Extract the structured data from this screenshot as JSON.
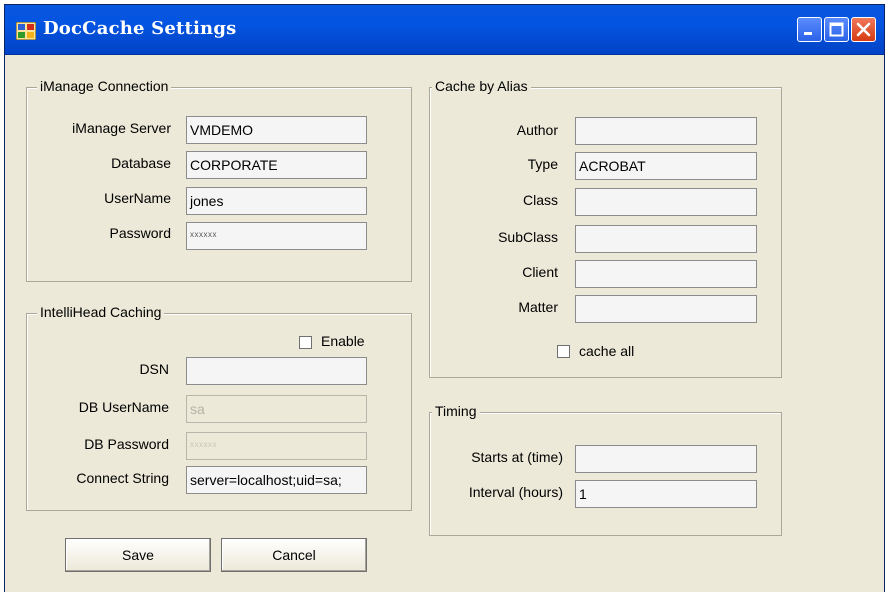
{
  "window": {
    "title": "DocCache Settings",
    "icons": {
      "app": "app-icon",
      "minimize": "minimize-icon",
      "maximize": "maximize-icon",
      "close": "close-icon"
    }
  },
  "imanage": {
    "legend": "iManage Connection",
    "server_label": "iManage Server",
    "server_value": "VMDEMO",
    "database_label": "Database",
    "database_value": "CORPORATE",
    "username_label": "UserName",
    "username_value": "jones",
    "password_label": "Password",
    "password_value": "xxxxxx"
  },
  "intellihead": {
    "legend": "IntelliHead Caching",
    "enable_label": "Enable",
    "enable_checked": false,
    "dsn_label": "DSN",
    "dsn_value": "",
    "db_username_label": "DB UserName",
    "db_username_value": "sa",
    "db_password_label": "DB Password",
    "db_password_value": "xxxxxx",
    "connect_label": "Connect String",
    "connect_value": "server=localhost;uid=sa;"
  },
  "alias": {
    "legend": "Cache by Alias",
    "author_label": "Author",
    "author_value": "",
    "type_label": "Type",
    "type_value": "ACROBAT",
    "class_label": "Class",
    "class_value": "",
    "subclass_label": "SubClass",
    "subclass_value": "",
    "client_label": "Client",
    "client_value": "",
    "matter_label": "Matter",
    "matter_value": "",
    "cache_all_label": "cache all",
    "cache_all_checked": false
  },
  "timing": {
    "legend": "Timing",
    "starts_label": "Starts at (time)",
    "starts_value": "",
    "interval_label": "Interval (hours)",
    "interval_value": "1"
  },
  "buttons": {
    "save": "Save",
    "cancel": "Cancel"
  }
}
